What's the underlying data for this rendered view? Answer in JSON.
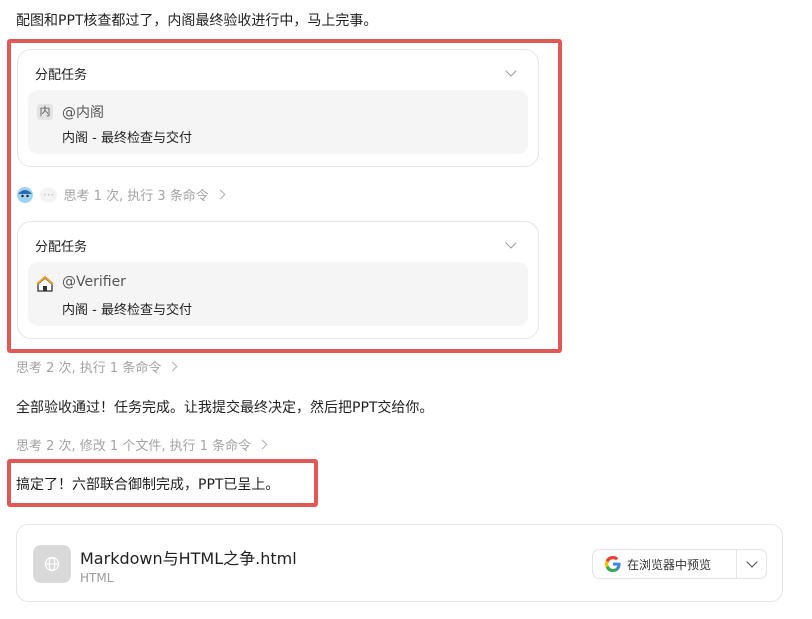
{
  "messages": {
    "intro": "配图和PPT核查都过了，内阁最终验收进行中，马上完事。",
    "accepted": "全部验收通过！任务完成。让我提交最终决定，然后把PPT交给你。",
    "done": "搞定了！六部联合御制完成，PPT已呈上。"
  },
  "meta": {
    "think1": "思考 1 次, 执行 3 条命令",
    "think2": "思考 2 次, 执行 1 条命令",
    "think3": "思考 2 次, 修改 1 个文件, 执行 1 条命令",
    "ellipsis": "···"
  },
  "tasks": [
    {
      "title": "分配任务",
      "avatar_char": "内",
      "assignee": "@内阁",
      "desc": "内阁 - 最终检查与交付"
    },
    {
      "title": "分配任务",
      "assignee": "@Verifier",
      "desc": "内阁 - 最终检查与交付"
    }
  ],
  "file": {
    "name": "Markdown与HTML之争.html",
    "type": "HTML",
    "preview_label": "在浏览器中预览"
  },
  "colors": {
    "highlight": "#e35757",
    "google_blue": "#4285F4",
    "google_red": "#EA4335",
    "google_yellow": "#FBBC05",
    "google_green": "#34A853"
  }
}
